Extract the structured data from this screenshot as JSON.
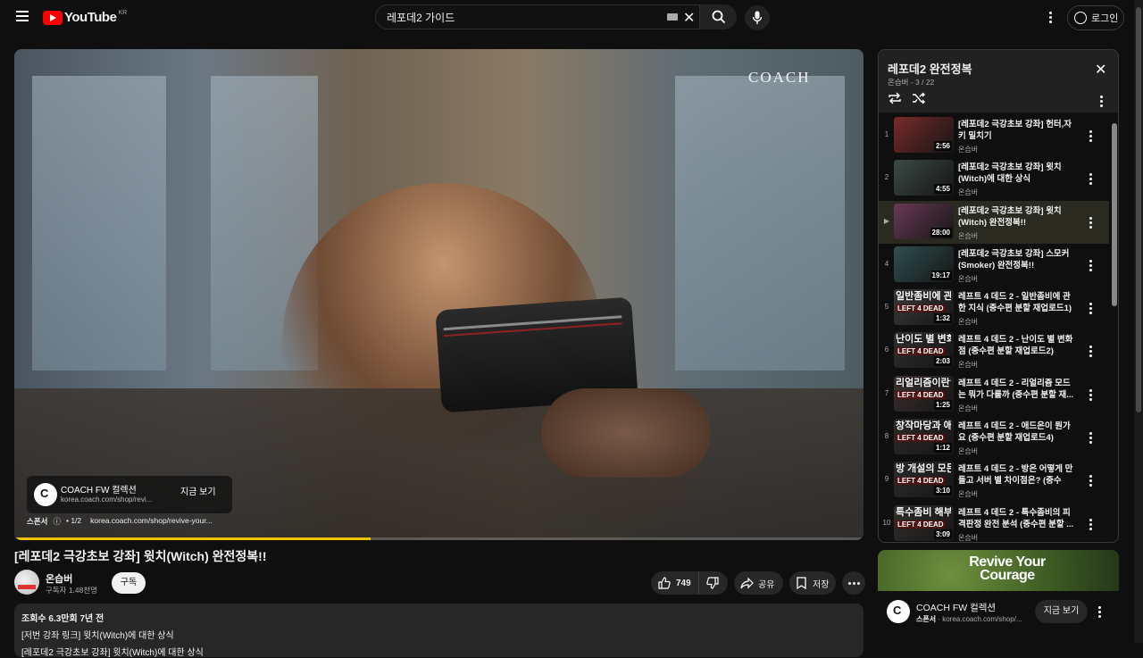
{
  "header": {
    "logo_text": "YouTube",
    "country_code": "KR",
    "search_value": "레포데2 가이드",
    "login_label": "로그인"
  },
  "player": {
    "overlay_brand": "COACH",
    "ad_title": "COACH FW 컬렉션",
    "ad_url": "korea.coach.com/shop/revi...",
    "ad_button": "지금 보기",
    "ad_sponsor": "스폰서",
    "ad_count": "1/2",
    "ad_full_url": "korea.coach.com/shop/revive-your...",
    "progress": 0.42,
    "progress_color": "#f2c200"
  },
  "video": {
    "title": "[레포데2 극강초보 강좌] 윗치(Witch) 완전정복!!",
    "channel_name": "온습버",
    "subscribers": "구독자 1.48천명",
    "subscribe_label": "구독",
    "likes": "749",
    "share_label": "공유",
    "save_label": "저장"
  },
  "description": {
    "stats": "조회수 6.3만회  7년 전",
    "line1": "[저번 강좌 링크] 윗치(Witch)에 대한 상식",
    "line2": "[레포데2 극강초보 강좌] 윗치(Witch)에 대한 상식"
  },
  "playlist": {
    "title": "레포데2 완전정복",
    "subtitle": "온습버 - 3 / 22",
    "items": [
      {
        "index": "1",
        "title": "[레포데2 극강초보 강좌] 헌터,자키 밀치기",
        "channel": "온습버",
        "duration": "2:56",
        "thumb_text": "",
        "l4d": ""
      },
      {
        "index": "2",
        "title": "[레포데2 극강초보 강좌] 윗치(Witch)에 대한 상식",
        "channel": "온습버",
        "duration": "4:55",
        "thumb_text": "",
        "l4d": ""
      },
      {
        "index": "▶",
        "title": "[레포데2 극강초보 강좌] 윗치(Witch) 완전정복!!",
        "channel": "온습버",
        "duration": "28:00",
        "thumb_text": "",
        "l4d": ""
      },
      {
        "index": "4",
        "title": "[레포데2 극강초보 강좌] 스모커(Smoker) 완전정복!!",
        "channel": "온습버",
        "duration": "19:17",
        "thumb_text": "",
        "l4d": ""
      },
      {
        "index": "5",
        "title": "레프트 4 데드 2 - 일반좀비에 관한 지식 (중수편 분할 재업로드1)",
        "channel": "온습버",
        "duration": "1:32",
        "thumb_text": "일반좀비에 관한 지",
        "l4d": "LEFT 4 DEAD"
      },
      {
        "index": "6",
        "title": "레프트 4 데드 2 - 난이도 별 변화점 (중수편 분할 재업로드2)",
        "channel": "온습버",
        "duration": "2:03",
        "thumb_text": "난이도 별 변화점",
        "l4d": "LEFT 4 DEAD"
      },
      {
        "index": "7",
        "title": "레프트 4 데드 2 - 리얼리즘 모드는 뭐가 다를까 (중수편 분할 재...",
        "channel": "온습버",
        "duration": "1:25",
        "thumb_text": "리얼리즘이란?",
        "l4d": "LEFT 4 DEAD"
      },
      {
        "index": "8",
        "title": "레프트 4 데드 2 - 애드온이 뭔가요 (중수편 분할 재업로드4)",
        "channel": "온습버",
        "duration": "1:12",
        "thumb_text": "창작마당과 애드온",
        "l4d": "LEFT 4 DEAD"
      },
      {
        "index": "9",
        "title": "레프트 4 데드 2 - 방은 어떻게 만들고 서버 별 차이점은? (중수편...",
        "channel": "온습버",
        "duration": "3:10",
        "thumb_text": "방 개설의 모든",
        "l4d": "LEFT 4 DEAD"
      },
      {
        "index": "10",
        "title": "레프트 4 데드 2 - 특수좀비의 피격판정 완전 분석 (중수편 분할 ...",
        "channel": "온습버",
        "duration": "3:09",
        "thumb_text": "특수좀비 해부학",
        "l4d": "LEFT 4 DEAD"
      }
    ]
  },
  "side_ad": {
    "image_text": "Revive Your Courage",
    "title": "COACH FW 컬렉션",
    "sponsor": "스폰서",
    "url": "korea.coach.com/shop/...",
    "button": "지금 보기"
  }
}
